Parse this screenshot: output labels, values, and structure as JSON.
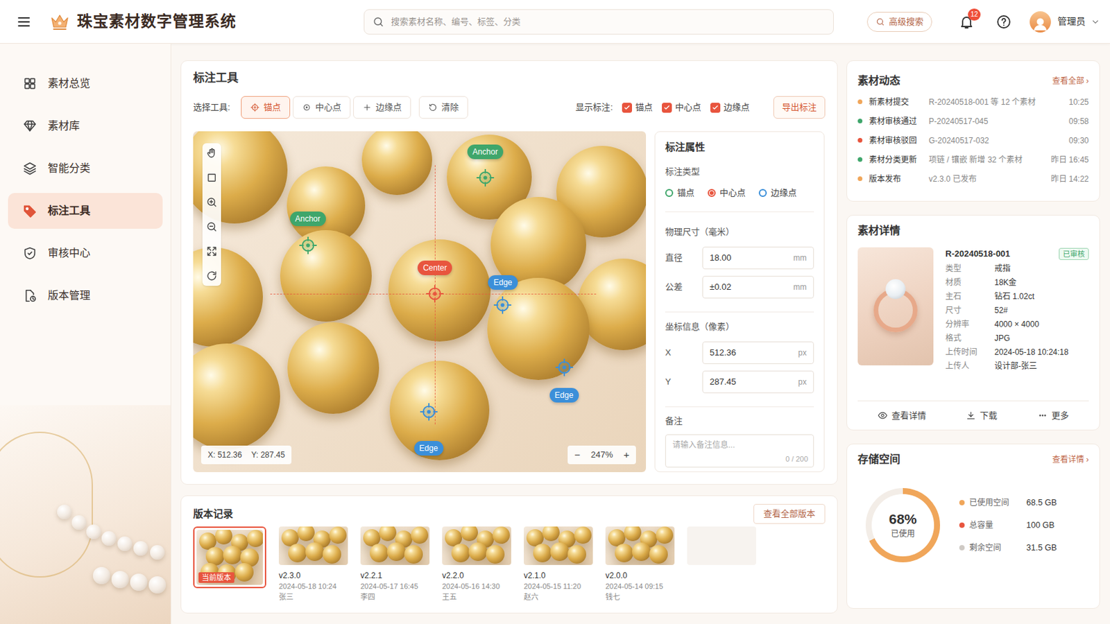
{
  "header": {
    "title": "珠宝素材数字管理系统",
    "search": {
      "placeholder": "搜索素材名称、编号、标签、分类"
    },
    "advanced_search": "高级搜索",
    "notification_count": "12",
    "user": "管理员"
  },
  "sidebar": {
    "items": [
      {
        "label": "素材总览",
        "selected": false
      },
      {
        "label": "素材库",
        "selected": false
      },
      {
        "label": "智能分类",
        "selected": false
      },
      {
        "label": "标注工具",
        "selected": true
      },
      {
        "label": "审核中心",
        "selected": false
      },
      {
        "label": "版本管理",
        "selected": false
      }
    ]
  },
  "annotation": {
    "title": "标注工具",
    "tool_label": "选择工具:",
    "tools": [
      {
        "label": "锚点",
        "selected": true
      },
      {
        "label": "中心点",
        "selected": false
      },
      {
        "label": "边缘点",
        "selected": false
      },
      {
        "label": "清除",
        "selected": false
      }
    ],
    "display_label": "显示标注:",
    "display": [
      {
        "label": "锚点",
        "checked": true
      },
      {
        "label": "中心点",
        "checked": true
      },
      {
        "label": "边缘点",
        "checked": true
      }
    ],
    "export": "导出标注",
    "canvas": {
      "markers": [
        {
          "label": "Anchor",
          "kind": "anchor",
          "color": "#3fa66b"
        },
        {
          "label": "Anchor",
          "kind": "anchor",
          "color": "#3fa66b"
        },
        {
          "label": "Center",
          "kind": "center",
          "color": "#e8553e"
        },
        {
          "label": "Edge",
          "kind": "edge",
          "color": "#3b8fd9"
        },
        {
          "label": "Edge",
          "kind": "edge",
          "color": "#3b8fd9"
        },
        {
          "label": "Edge",
          "kind": "edge",
          "color": "#3b8fd9"
        }
      ],
      "cursor_x": "X: 512.36",
      "cursor_y": "Y: 287.45",
      "zoom_out": "−",
      "zoom": "247%",
      "zoom_in": "+"
    }
  },
  "properties": {
    "title": "标注属性",
    "type_label": "标注类型",
    "types": [
      {
        "label": "锚点",
        "selected": false,
        "color": "#3fa66b"
      },
      {
        "label": "中心点",
        "selected": true,
        "color": "#e8553e"
      },
      {
        "label": "边缘点",
        "selected": false,
        "color": "#3b8fd9"
      }
    ],
    "size_label": "物理尺寸（毫米）",
    "size_fields": [
      {
        "label": "直径",
        "value": "18.00",
        "unit": "mm"
      },
      {
        "label": "公差",
        "value": "±0.02",
        "unit": "mm"
      }
    ],
    "coord_label": "坐标信息（像素）",
    "coord_fields": [
      {
        "label": "X",
        "value": "512.36",
        "unit": "px"
      },
      {
        "label": "Y",
        "value": "287.45",
        "unit": "px"
      }
    ],
    "note_label": "备注",
    "note_placeholder": "请输入备注信息...",
    "note_count": "0 / 200"
  },
  "versions": {
    "title": "版本记录",
    "view_all": "查看全部版本",
    "items": [
      {
        "kind": "current",
        "tag": "当前版本",
        "selected": true
      },
      {
        "kind": "version",
        "version": "v2.3.0",
        "time": "2024-05-18 10:24",
        "author": "张三",
        "selected": false
      },
      {
        "kind": "version",
        "version": "v2.2.1",
        "time": "2024-05-17 16:45",
        "author": "李四",
        "selected": false
      },
      {
        "kind": "version",
        "version": "v2.2.0",
        "time": "2024-05-16 14:30",
        "author": "王五",
        "selected": false
      },
      {
        "kind": "version",
        "version": "v2.1.0",
        "time": "2024-05-15 11:20",
        "author": "赵六",
        "selected": false
      },
      {
        "kind": "version",
        "version": "v2.0.0",
        "time": "2024-05-14 09:15",
        "author": "钱七",
        "selected": false
      },
      {
        "kind": "empty",
        "selected": false
      }
    ]
  },
  "activity": {
    "title": "素材动态",
    "view_all": "查看全部 ›",
    "items": [
      {
        "label": "新素材提交",
        "detail": "R-20240518-001 等 12 个素材",
        "time": "10:25",
        "color": "#f0a65a"
      },
      {
        "label": "素材审核通过",
        "detail": "P-20240517-045",
        "time": "09:58",
        "color": "#3fa66b"
      },
      {
        "label": "素材审核驳回",
        "detail": "G-20240517-032",
        "time": "09:30",
        "color": "#e8553e"
      },
      {
        "label": "素材分类更新",
        "detail": "项链 / 镶嵌 新增 32 个素材",
        "time": "昨日 16:45",
        "color": "#3fa66b"
      },
      {
        "label": "版本发布",
        "detail": "v2.3.0 已发布",
        "time": "昨日 14:22",
        "color": "#f0a65a"
      }
    ]
  },
  "detail": {
    "title": "素材详情",
    "id": "R-20240518-001",
    "status": "已审核",
    "fields": [
      {
        "label": "类型",
        "value": "戒指"
      },
      {
        "label": "材质",
        "value": "18K金"
      },
      {
        "label": "主石",
        "value": "钻石 1.02ct"
      },
      {
        "label": "尺寸",
        "value": "52#"
      },
      {
        "label": "分辨率",
        "value": "4000 × 4000"
      },
      {
        "label": "格式",
        "value": "JPG"
      },
      {
        "label": "上传时间",
        "value": "2024-05-18 10:24:18"
      },
      {
        "label": "上传人",
        "value": "设计部-张三"
      }
    ],
    "actions": [
      "查看详情",
      "下载",
      "更多"
    ]
  },
  "storage": {
    "title": "存储空间",
    "view_details": "查看详情 ›",
    "level": 0.68,
    "percent": "68%",
    "percent_label": "已使用",
    "legend": [
      {
        "label": "已使用空间",
        "value": "68.5 GB",
        "color": "#f0a65a"
      },
      {
        "label": "总容量",
        "value": "100 GB",
        "color": "#e8553e"
      },
      {
        "label": "剩余空间",
        "value": "31.5 GB",
        "color": "#cfcac5"
      }
    ]
  }
}
